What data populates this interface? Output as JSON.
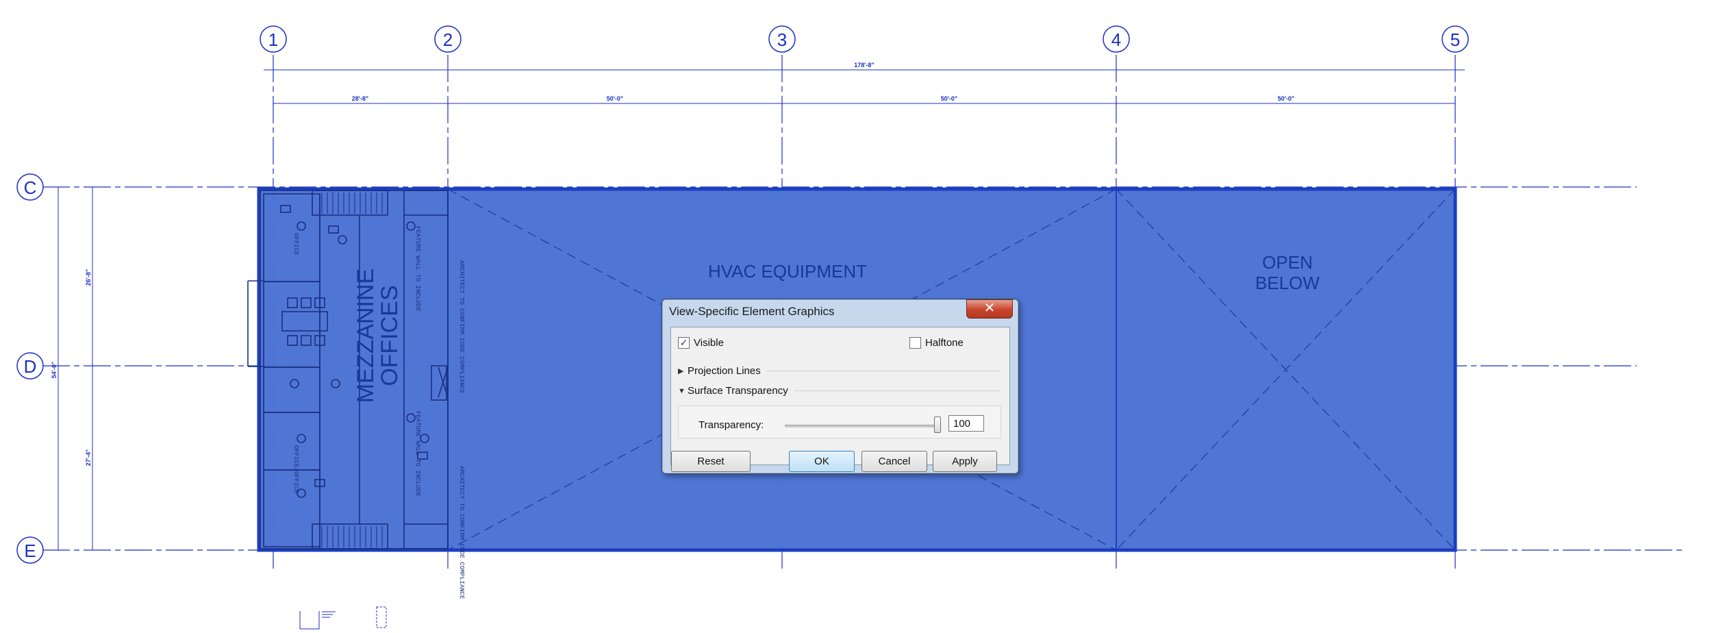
{
  "drawing": {
    "grid_columns": [
      "1",
      "2",
      "3",
      "4",
      "5"
    ],
    "grid_rows": [
      "C",
      "D",
      "E"
    ],
    "overall_dimension": "178'-8\"",
    "bay_dimensions": [
      "28'-8\"",
      "50'-0\"",
      "50'-0\"",
      "50'-0\""
    ],
    "vertical_dimensions": {
      "total": "54'-0\"",
      "upper": "26'-8\"",
      "lower": "27'-4\""
    },
    "rooms": {
      "hvac": "HVAC EQUIPMENT",
      "open_below_line1": "OPEN",
      "open_below_line2": "BELOW",
      "mezzanine": "MEZZANINE",
      "offices": "OFFICES"
    },
    "notes": {
      "office_a": "OFFICE",
      "office_b": "OFFICE/OFFICE",
      "note_upper": "FEATURE WALL TO INCLUDE",
      "note_lower": "FEATURE WALL TO INCLUDE",
      "compliance_upper": "ARCHITECT TO CONFIRM CODE COMPLIANCE",
      "compliance_lower": "ARCHITECT TO CONFIRM CODE COMPLIANCE"
    },
    "colors": {
      "overlay": "#3f69d2",
      "line": "#1a2fc4"
    }
  },
  "dialog": {
    "title": "View-Specific Element Graphics",
    "close_glyph": "✕",
    "visible_label": "Visible",
    "visible_checked": true,
    "halftone_label": "Halftone",
    "halftone_checked": false,
    "projection_lines_label": "Projection Lines",
    "surface_transparency_label": "Surface Transparency",
    "transparency_label": "Transparency:",
    "transparency_value": "100",
    "buttons": {
      "reset": "Reset",
      "ok": "OK",
      "cancel": "Cancel",
      "apply": "Apply"
    }
  }
}
